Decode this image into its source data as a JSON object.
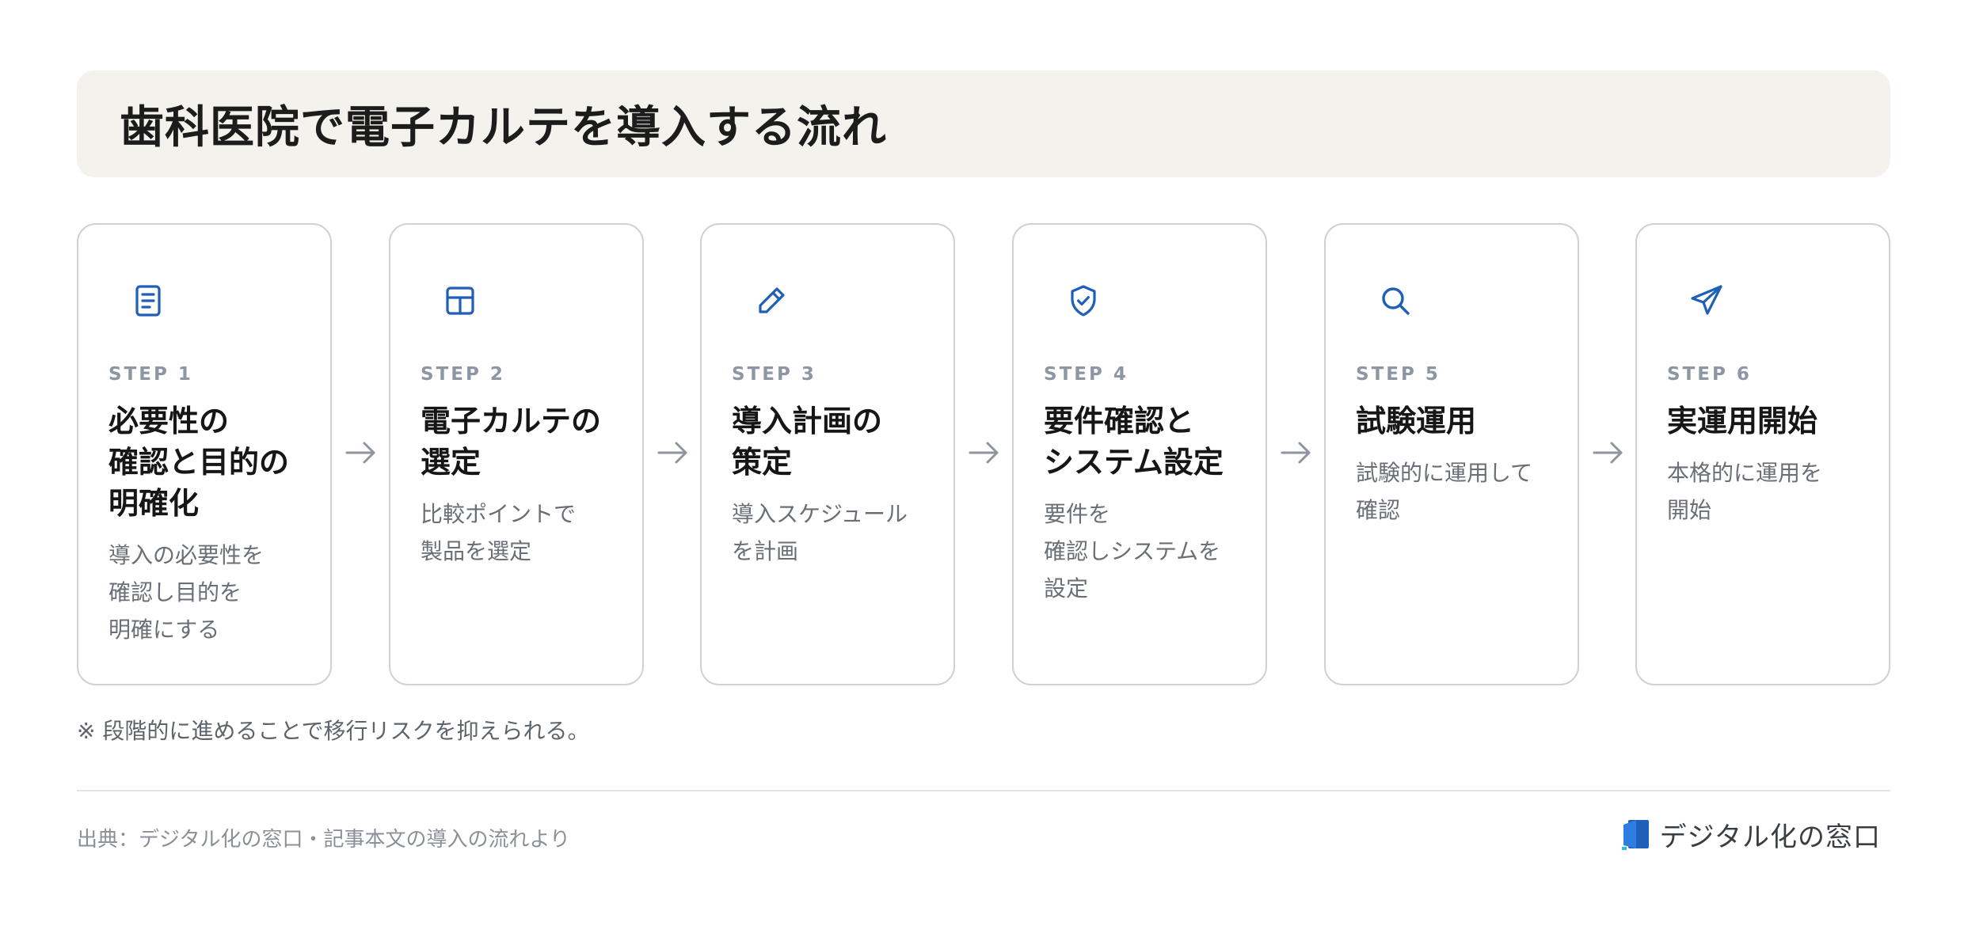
{
  "title": "歯科医院で電子カルテを導入する流れ",
  "steps": [
    {
      "label": "STEP 1",
      "title": "必要性の\n確認と目的の\n明確化",
      "desc": "導入の必要性を\n確認し目的を\n明確にする",
      "icon": "document-icon"
    },
    {
      "label": "STEP 2",
      "title": "電子カルテの\n選定",
      "desc": "比較ポイントで\n製品を選定",
      "icon": "table-icon"
    },
    {
      "label": "STEP 3",
      "title": "導入計画の\n策定",
      "desc": "導入スケジュール\nを計画",
      "icon": "pencil-icon"
    },
    {
      "label": "STEP 4",
      "title": "要件確認と\nシステム設定",
      "desc": "要件を\n確認しシステムを\n設定",
      "icon": "shield-check-icon"
    },
    {
      "label": "STEP 5",
      "title": "試験運用",
      "desc": "試験的に運用して\n確認",
      "icon": "search-icon"
    },
    {
      "label": "STEP 6",
      "title": "実運用開始",
      "desc": "本格的に運用を\n開始",
      "icon": "send-icon"
    }
  ],
  "note": "※ 段階的に進めることで移行リスクを抑えられる。",
  "source": "出典：デジタル化の窓口・記事本文の導入の流れより",
  "brand": {
    "name": "デジタル化の窓口"
  },
  "colors": {
    "accent": "#1f5fb8",
    "title_bg": "#f4f2ec",
    "card_border": "#cfd1d4"
  }
}
